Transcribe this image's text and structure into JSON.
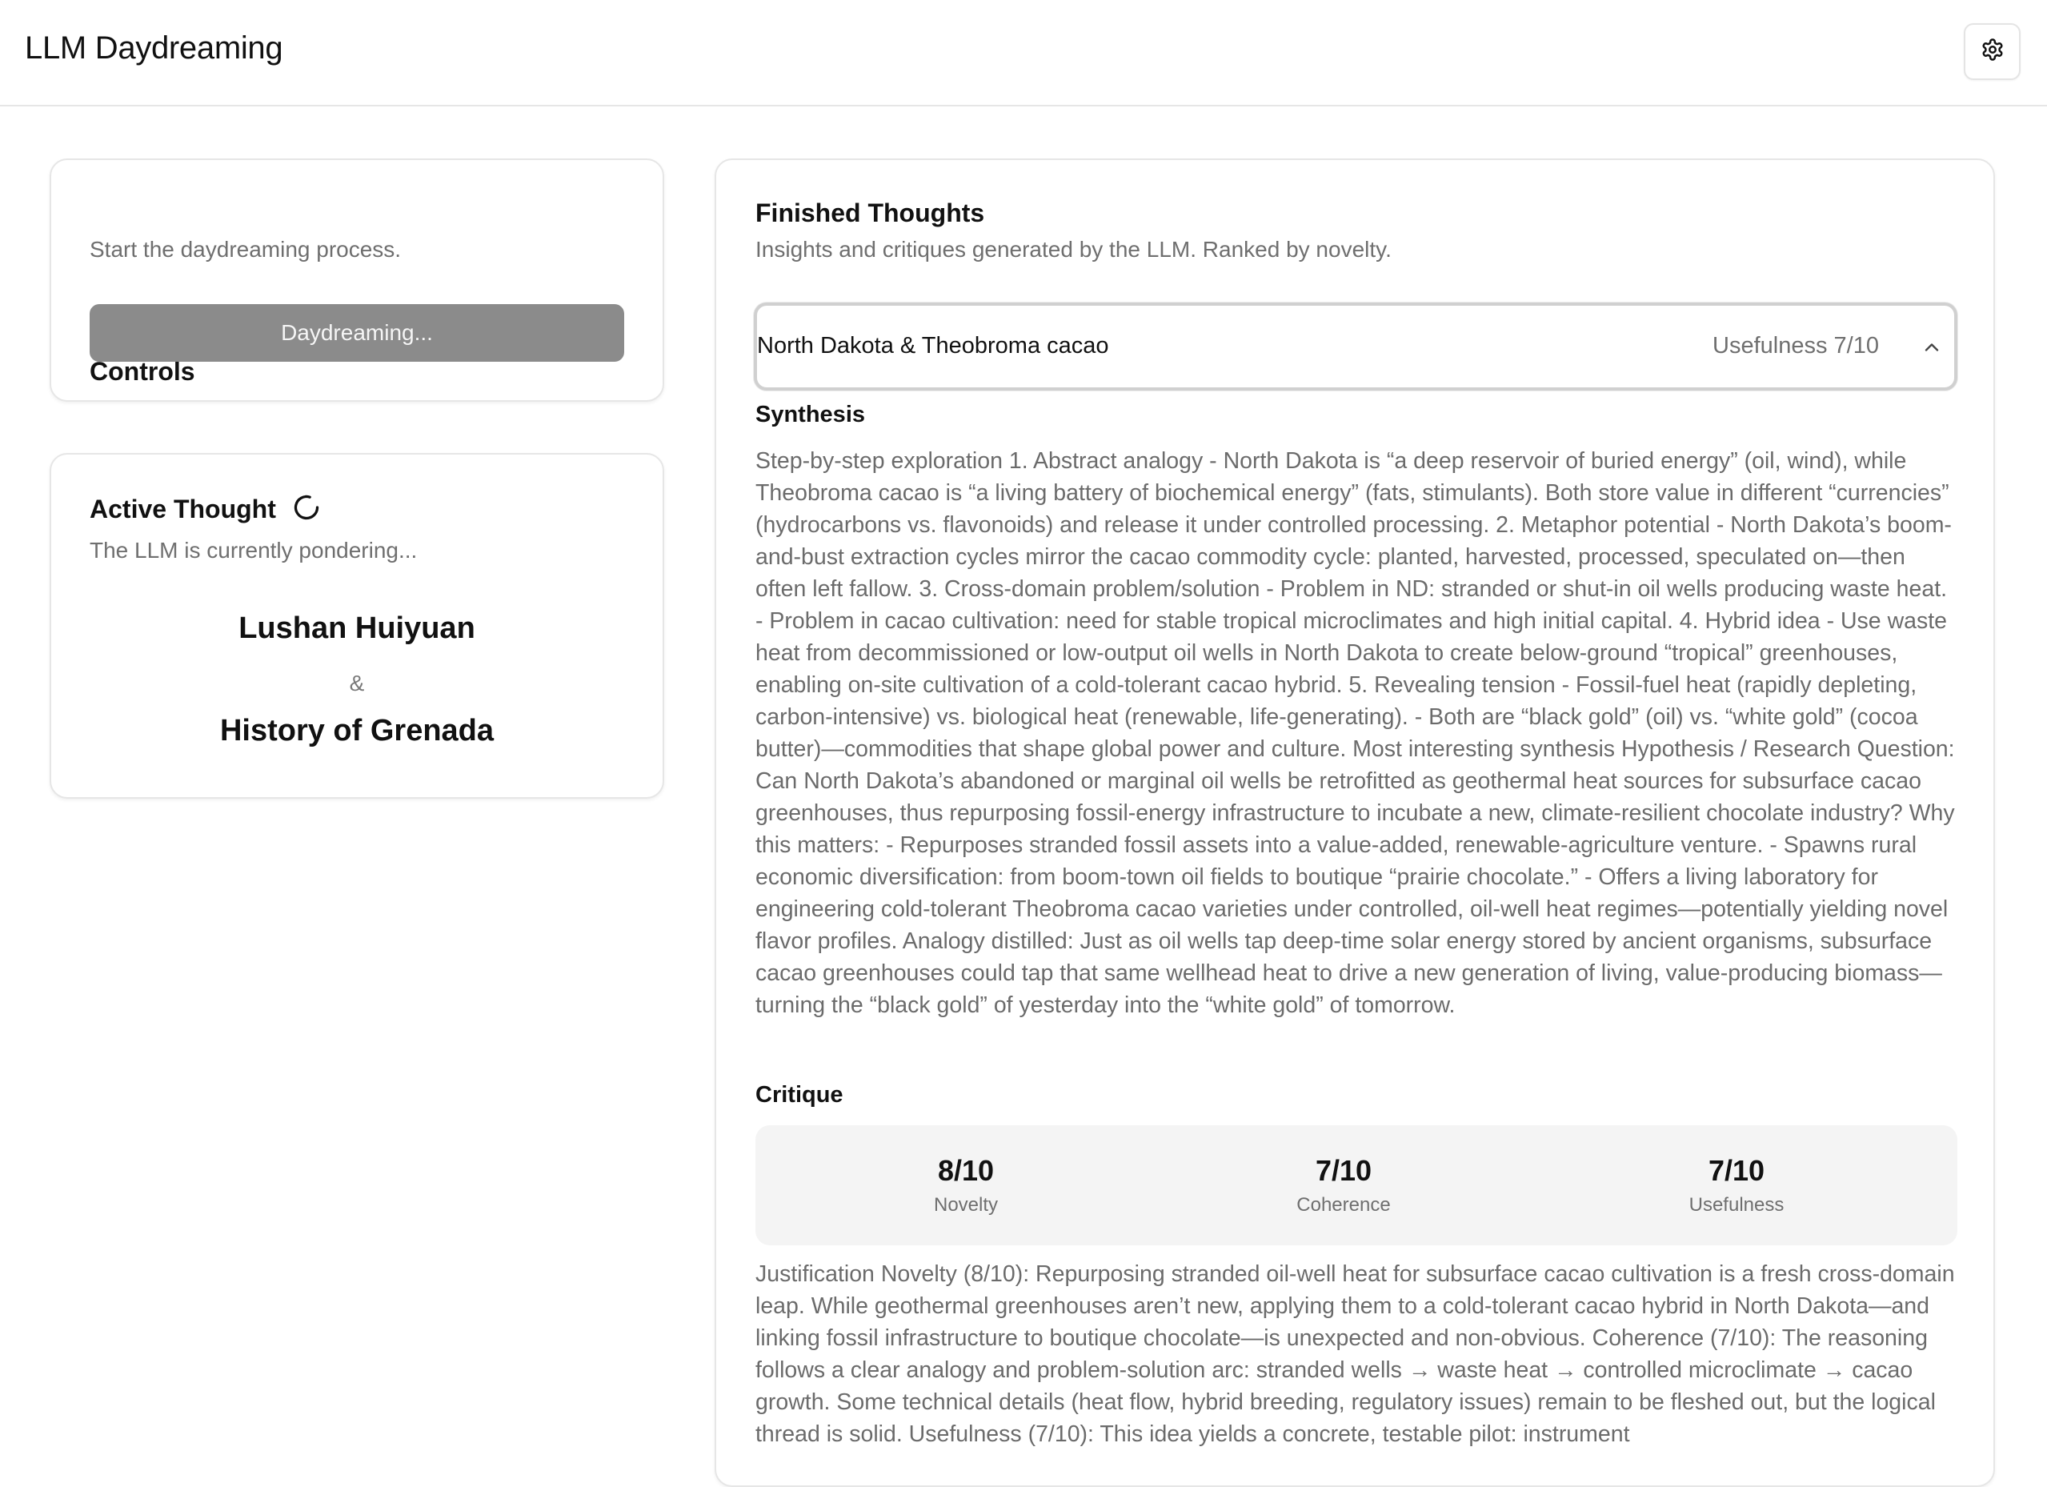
{
  "header": {
    "title": "LLM Daydreaming",
    "settings_icon": "gear-icon"
  },
  "controls": {
    "title": "Controls",
    "subtitle": "Start the daydreaming process.",
    "button_label": "Daydreaming..."
  },
  "active_thought": {
    "title": "Active Thought",
    "spinner_icon": "spinner-icon",
    "subtitle": "The LLM is currently pondering...",
    "concept_a": "Lushan Huiyuan",
    "connector": "&",
    "concept_b": "History of Grenada"
  },
  "finished_thoughts": {
    "title": "Finished Thoughts",
    "subtitle": "Insights and critiques generated by the LLM. Ranked by novelty.",
    "items": [
      {
        "topic": "North Dakota & Theobroma cacao",
        "usefulness_label": "Usefulness 7/10",
        "expanded": true,
        "synthesis_label": "Synthesis",
        "synthesis": "Step-by-step exploration 1. Abstract analogy - North Dakota is “a deep reservoir of buried energy” (oil, wind), while Theobroma cacao is “a living battery of biochemical energy” (fats, stimulants). Both store value in different “currencies” (hydrocarbons vs. flavonoids) and release it under controlled processing. 2. Metaphor potential - North Dakota’s boom-and-bust extraction cycles mirror the cacao commodity cycle: planted, harvested, processed, speculated on—then often left fallow. 3. Cross-domain problem/solution - Problem in ND: stranded or shut-in oil wells producing waste heat. - Problem in cacao cultivation: need for stable tropical microclimates and high initial capital. 4. Hybrid idea - Use waste heat from decommissioned or low-output oil wells in North Dakota to create below-ground “tropical” greenhouses, enabling on-site cultivation of a cold-tolerant cacao hybrid. 5. Revealing tension - Fossil-fuel heat (rapidly depleting, carbon-intensive) vs. biological heat (renewable, life-generating). - Both are “black gold” (oil) vs. “white gold” (cocoa butter)—commodities that shape global power and culture. Most interesting synthesis Hypothesis / Research Question: Can North Dakota’s abandoned or marginal oil wells be retrofitted as geothermal heat sources for subsurface cacao greenhouses, thus repurposing fossil-energy infrastructure to incubate a new, climate-resilient chocolate industry? Why this matters: - Repurposes stranded fossil assets into a value-added, renewable-agriculture venture. - Spawns rural economic diversification: from boom-town oil fields to boutique “prairie chocolate.” - Offers a living laboratory for engineering cold-tolerant Theobroma cacao varieties under controlled, oil-well heat regimes—potentially yielding novel flavor profiles. Analogy distilled: Just as oil wells tap deep-time solar energy stored by ancient organisms, subsurface cacao greenhouses could tap that same wellhead heat to drive a new generation of living, value-producing biomass—turning the “black gold” of yesterday into the “white gold” of tomorrow.",
        "critique_label": "Critique",
        "scores": [
          {
            "value": "8/10",
            "label": "Novelty"
          },
          {
            "value": "7/10",
            "label": "Coherence"
          },
          {
            "value": "7/10",
            "label": "Usefulness"
          }
        ],
        "justification": "Justification Novelty (8/10): Repurposing stranded oil-well heat for subsurface cacao cultivation is a fresh cross-domain leap. While geothermal greenhouses aren’t new, applying them to a cold-tolerant cacao hybrid in North Dakota—and linking fossil infrastructure to boutique chocolate—is unexpected and non-obvious. Coherence (7/10): The reasoning follows a clear analogy and problem-solution arc: stranded wells → waste heat → controlled microclimate → cacao growth. Some technical details (heat flow, hybrid breeding, regulatory issues) remain to be fleshed out, but the logical thread is solid. Usefulness (7/10): This idea yields a concrete, testable pilot: instrument"
      }
    ]
  }
}
